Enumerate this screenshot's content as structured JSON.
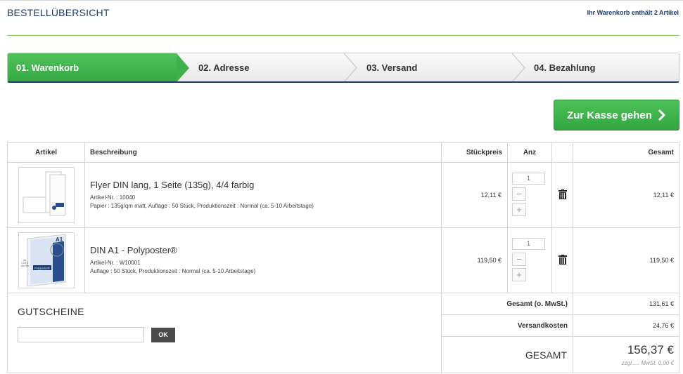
{
  "header": {
    "title": "BESTELLÜBERSICHT",
    "cart_info": "Ihr Warenkorb enthält 2 Artikel"
  },
  "steps": [
    {
      "label": "01. Warenkorb",
      "active": true
    },
    {
      "label": "02. Adresse",
      "active": false
    },
    {
      "label": "03. Versand",
      "active": false
    },
    {
      "label": "04. Bezahlung",
      "active": false
    }
  ],
  "checkout": {
    "label": "Zur Kasse gehen",
    "icon": "chevron-right-icon"
  },
  "table": {
    "headers": {
      "article": "Artikel",
      "description": "Beschreibung",
      "unit_price": "Stückpreis",
      "qty": "Anz",
      "total": "Gesamt"
    },
    "items": [
      {
        "name": "Flyer DIN lang, 1 Seite (135g), 4/4 farbig",
        "article_no": "Artikel-Nr. : 10040",
        "details": "Papier : 135g/qm matt, Auflage : 50 Stück, Produktionszeit : Normal (ca. 5-10 Arbeitstage)",
        "unit_price": "12,11 €",
        "qty": "1",
        "total": "12,11 €"
      },
      {
        "name": "DIN A1 - Polyposter®",
        "article_no": "Artikel-Nr. : W10001",
        "details": "Auflage : 50 Stück, Produktionszeit : Normal (ca. 5-10 Arbeitstage)",
        "unit_price": "119,50 €",
        "qty": "1",
        "total": "119,50 €"
      }
    ],
    "qty_minus": "−",
    "qty_plus": "+"
  },
  "voucher": {
    "title": "GUTSCHEINE",
    "button": "OK",
    "placeholder": ""
  },
  "summary": {
    "net_label": "Gesamt (o. MwSt.)",
    "net_value": "131,61 €",
    "shipping_label": "Versandkosten",
    "shipping_value": "24,76 €",
    "grand_label": "GESAMT",
    "grand_value": "156,37 €",
    "tax_note": "zzgl..... MwSt. 0,00 €"
  },
  "thumbnail_text": {
    "poster_badge": "A1",
    "poster_brand": "Polyposter®",
    "poster_price_a": "ab",
    "poster_price_b": "1,24 €",
    "poster_price_c": "pro Stk."
  },
  "colors": {
    "accent_green": "#3db24a",
    "brand_navy": "#1c3a6b"
  }
}
